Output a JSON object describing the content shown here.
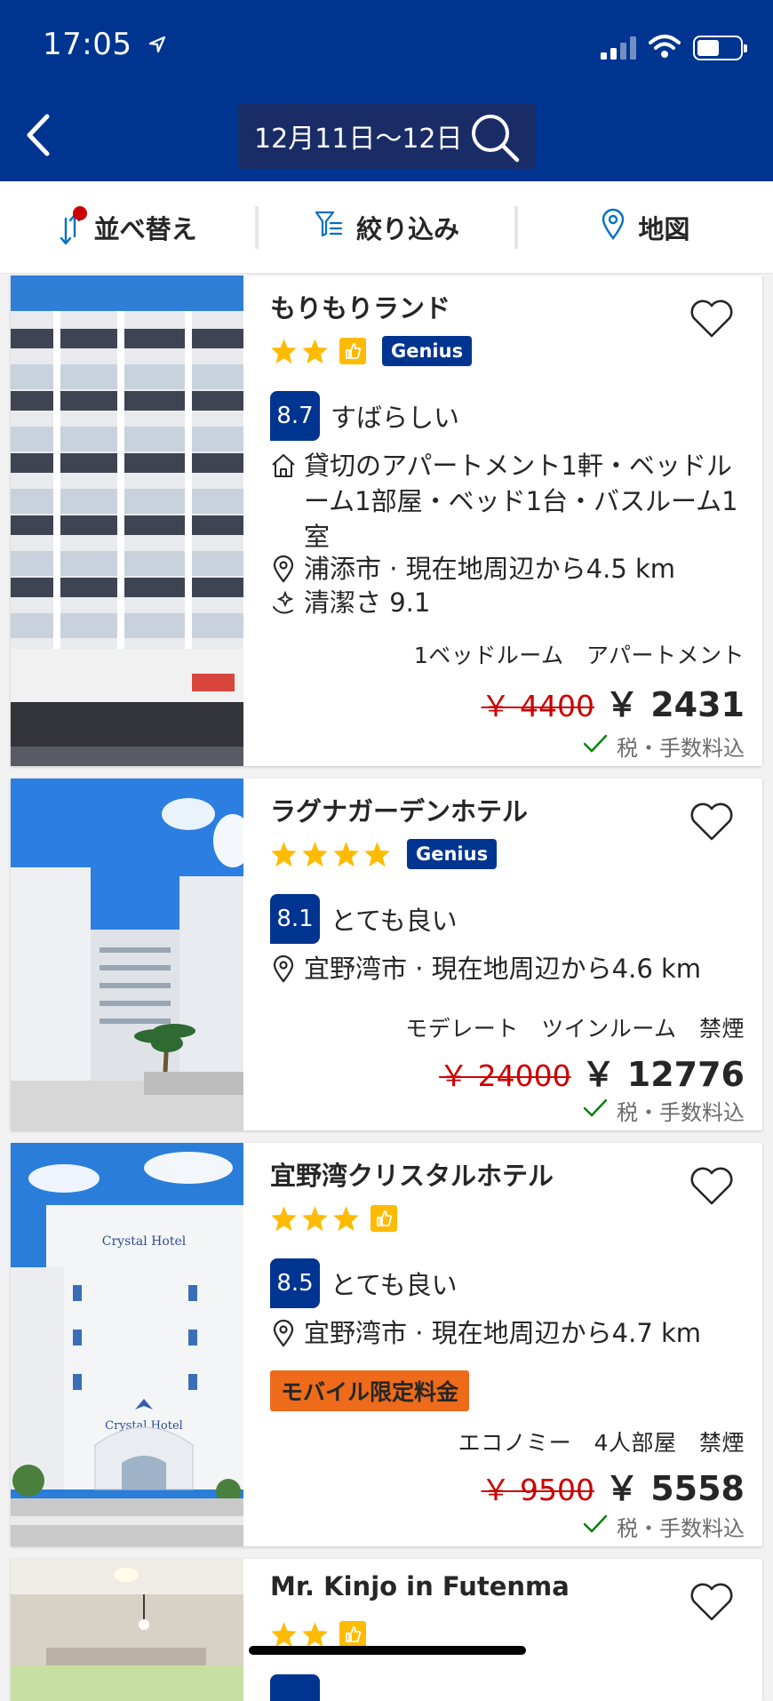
{
  "status_bar": {
    "time": "17:05"
  },
  "header": {
    "dates": "12月11日〜12日"
  },
  "toolbar": {
    "sort_label": "並べ替え",
    "filter_label": "絞り込み",
    "map_label": "地図"
  },
  "hotels": [
    {
      "name": "もりもりランド",
      "stars": 2,
      "thumbs_up": true,
      "genius": "Genius",
      "score": "8.7",
      "score_word": "すばらしい",
      "property_info": "貸切のアパートメント1軒・ベッドルーム1部屋・ベッド1台・バスルーム1室",
      "location": "浦添市 · 現在地周辺から4.5 km",
      "cleanliness": "清潔さ 9.1",
      "room": "1ベッドルーム　アパートメント",
      "old_price": "￥ 4400",
      "new_price": "￥ 2431",
      "tax": "税・手数料込"
    },
    {
      "name": "ラグナガーデンホテル",
      "stars": 4,
      "thumbs_up": false,
      "genius": "Genius",
      "score": "8.1",
      "score_word": "とても良い",
      "location": "宜野湾市 · 現在地周辺から4.6 km",
      "room": "モデレート　ツインルーム　禁煙",
      "old_price": "￥ 24000",
      "new_price": "￥ 12776",
      "tax": "税・手数料込"
    },
    {
      "name": "宜野湾クリスタルホテル",
      "stars": 3,
      "thumbs_up": true,
      "score": "8.5",
      "score_word": "とても良い",
      "location": "宜野湾市 · 現在地周辺から4.7 km",
      "badge": "モバイル限定料金",
      "room": "エコノミー　4人部屋　禁煙",
      "old_price": "￥ 9500",
      "new_price": "￥ 5558",
      "tax": "税・手数料込",
      "image_text": "宜野湾 Crystal Hotel"
    },
    {
      "name": "Mr. Kinjo in Futenma",
      "stars": 2,
      "thumbs_up": true
    }
  ],
  "colors": {
    "brand": "#003491",
    "star": "#febb02",
    "discount": "#cc0000",
    "badge": "#ed6b1a",
    "check": "#008009"
  }
}
